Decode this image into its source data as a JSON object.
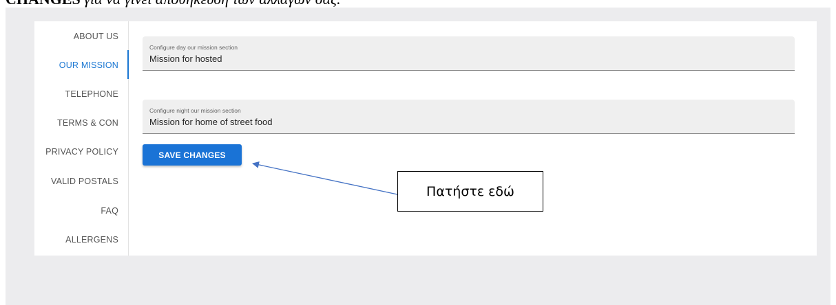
{
  "document": {
    "heading_bold": "CHANGES",
    "heading_rest": " για να γίνει αποθήκευση των αλλαγών σας."
  },
  "tabs": [
    {
      "label": "ABOUT US",
      "active": false
    },
    {
      "label": "OUR MISSION",
      "active": true
    },
    {
      "label": "TELEPHONE",
      "active": false
    },
    {
      "label": "TERMS & CON",
      "active": false
    },
    {
      "label": "PRIVACY POLICY",
      "active": false
    },
    {
      "label": "VALID POSTALS",
      "active": false
    },
    {
      "label": "FAQ",
      "active": false
    },
    {
      "label": "ALLERGENS",
      "active": false
    }
  ],
  "form": {
    "day_field": {
      "label": "Configure day our mission section",
      "value": "Mission for hosted"
    },
    "night_field": {
      "label": "Configure night our mission section",
      "value": "Mission for home of street food"
    },
    "save_label": "SAVE CHANGES"
  },
  "annotation": {
    "callout_text": "Πατήστε εδώ",
    "arrow_color": "#4472c4"
  },
  "colors": {
    "accent": "#1976d2",
    "background": "#ececee"
  }
}
